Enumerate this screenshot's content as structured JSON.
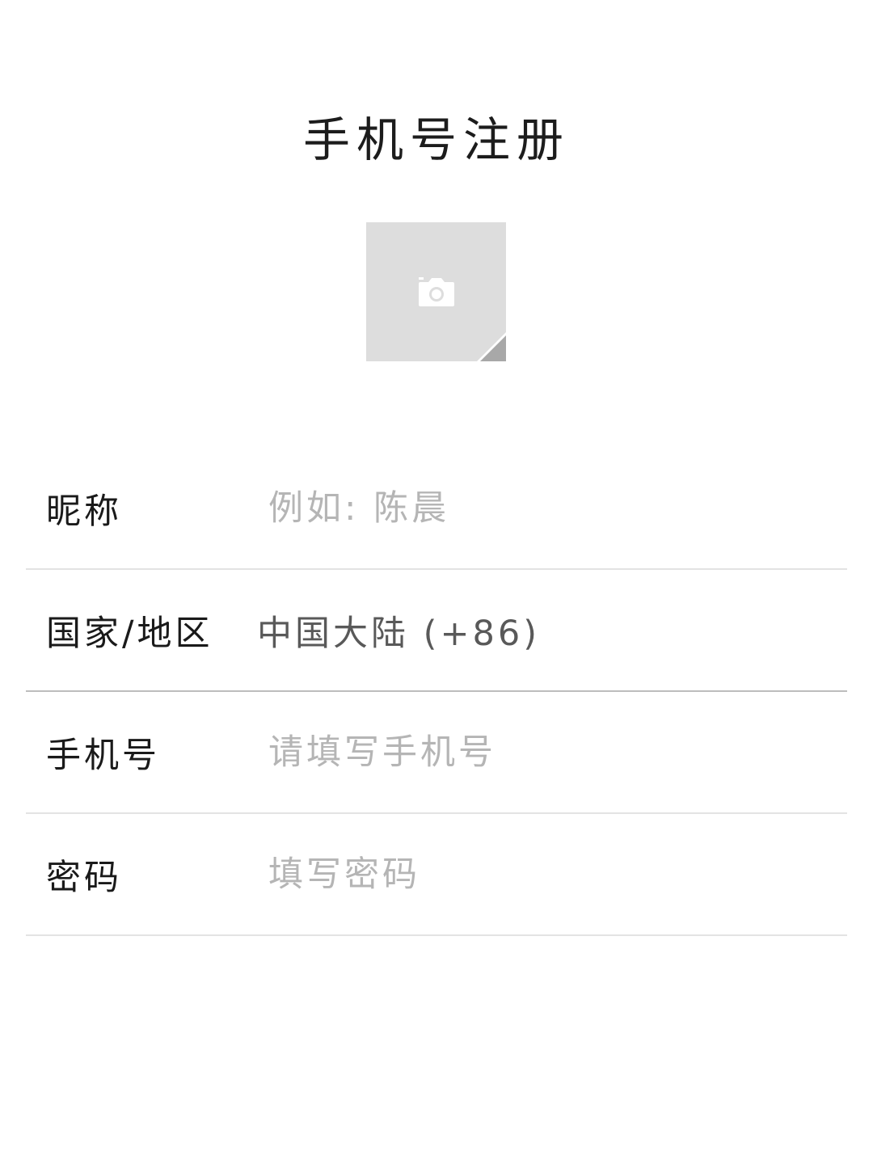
{
  "page": {
    "title": "手机号注册"
  },
  "avatar": {
    "icon": "camera-icon"
  },
  "form": {
    "nickname": {
      "label": "昵称",
      "placeholder": "例如: 陈晨",
      "value": ""
    },
    "region": {
      "label": "国家/地区",
      "value": "中国大陆 (+86)"
    },
    "phone": {
      "label": "手机号",
      "placeholder": "请填写手机号",
      "value": ""
    },
    "password": {
      "label": "密码",
      "placeholder": "填写密码",
      "value": ""
    }
  },
  "colors": {
    "background": "#ffffff",
    "title": "#1c1c1c",
    "label": "#1a1a1a",
    "placeholder": "#b5b5b5",
    "region_value": "#595959",
    "divider": "#e3e3e3",
    "avatar_bg": "#dddddd"
  }
}
